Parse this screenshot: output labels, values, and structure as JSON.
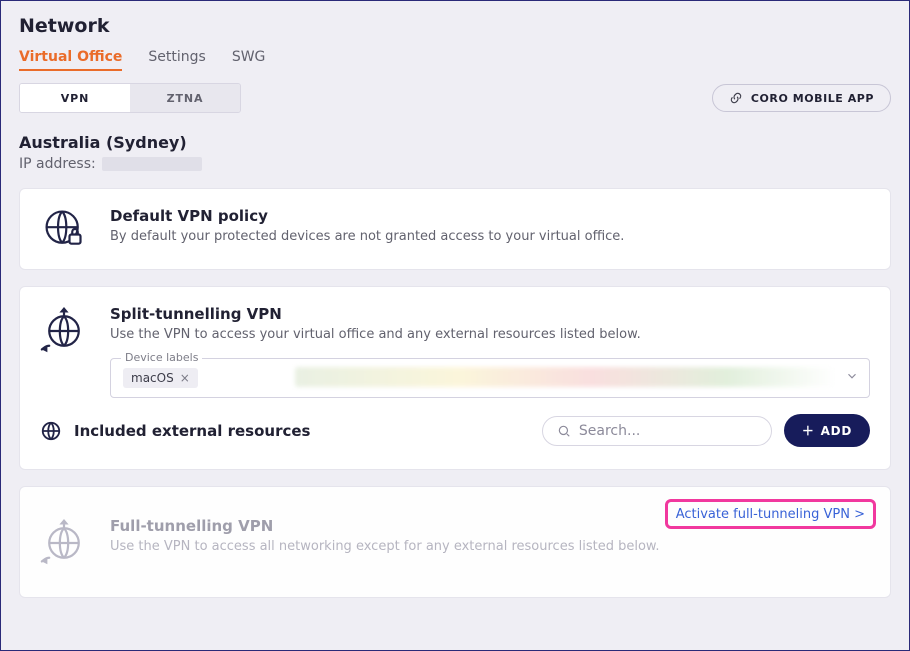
{
  "page_title": "Network",
  "tabs": {
    "virtual_office": "Virtual Office",
    "settings": "Settings",
    "swg": "SWG"
  },
  "subtabs": {
    "vpn": "VPN",
    "ztna": "ZTNA"
  },
  "mobile_app_button": "CORO MOBILE APP",
  "location": {
    "name": "Australia (Sydney)",
    "ip_label": "IP address:"
  },
  "default_policy": {
    "title": "Default VPN policy",
    "desc": "By default your protected devices are not granted access to your virtual office."
  },
  "split_tunnel": {
    "title": "Split-tunnelling VPN",
    "desc": "Use the VPN to access your virtual office and any external resources listed below.",
    "labels_legend": "Device labels",
    "chips": {
      "macos": "macOS",
      "close": "×"
    }
  },
  "external": {
    "title": "Included external resources",
    "search_placeholder": "Search...",
    "add_label": "ADD"
  },
  "full_tunnel": {
    "title": "Full-tunnelling VPN",
    "desc": "Use the VPN to access all networking except for any external resources listed below.",
    "activate_label": "Activate full-tunneling VPN >"
  }
}
